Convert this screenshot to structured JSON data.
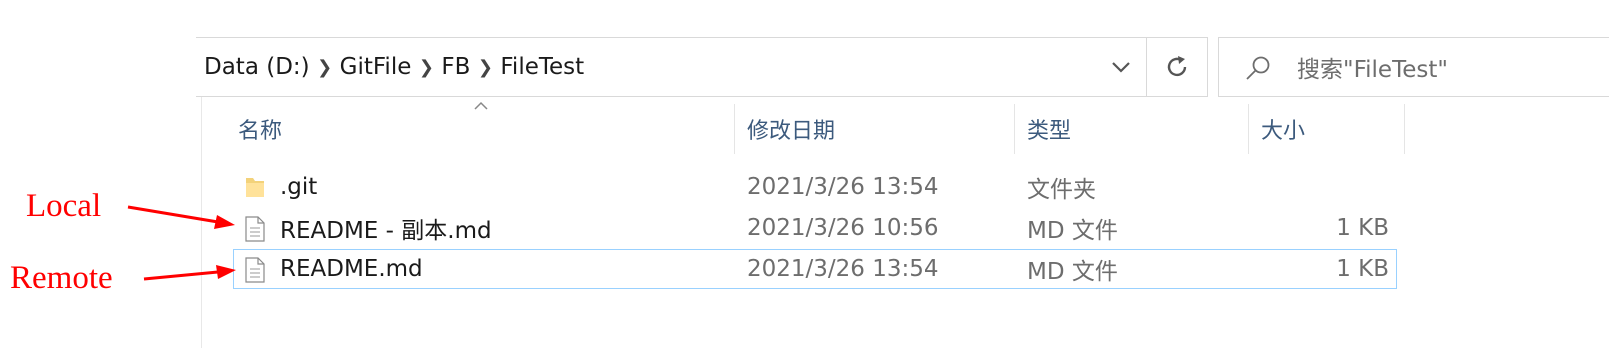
{
  "address_bar": {
    "crumbs": [
      "Data (D:)",
      "GitFile",
      "FB",
      "FileTest"
    ]
  },
  "search": {
    "placeholder": "搜索\"FileTest\""
  },
  "columns": {
    "name": "名称",
    "date": "修改日期",
    "type": "类型",
    "size": "大小"
  },
  "files": [
    {
      "name": ".git",
      "date": "2021/3/26 13:54",
      "type": "文件夹",
      "size": "",
      "icon": "folder-icon"
    },
    {
      "name": "README - 副本.md",
      "date": "2021/3/26 10:56",
      "type": "MD 文件",
      "size": "1 KB",
      "icon": "document-icon"
    },
    {
      "name": "README.md",
      "date": "2021/3/26 13:54",
      "type": "MD 文件",
      "size": "1 KB",
      "icon": "document-icon",
      "selected": true
    }
  ],
  "annotations": {
    "local": "Local",
    "remote": "Remote",
    "color": "#ff0000"
  },
  "colors": {
    "header_text": "#3c5a7d",
    "selection_border": "#99d1ff"
  }
}
